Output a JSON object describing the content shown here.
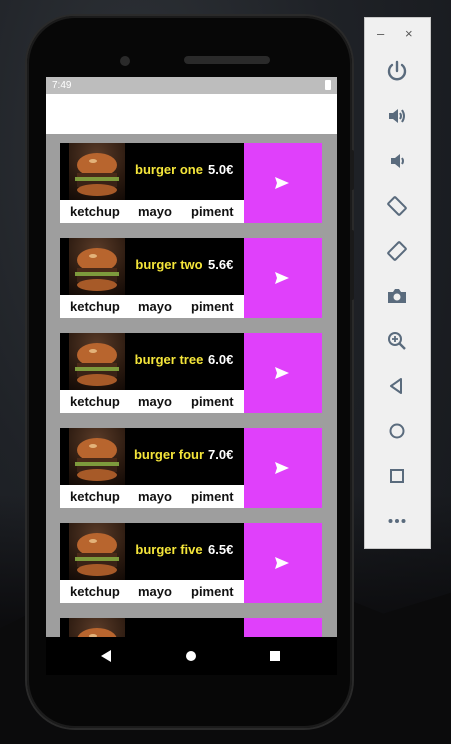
{
  "status_bar": {
    "time": "7:49"
  },
  "items": [
    {
      "name": "burger one",
      "price": "5.0€",
      "sauces": [
        "ketchup",
        "mayo",
        "piment"
      ]
    },
    {
      "name": "burger two",
      "price": "5.6€",
      "sauces": [
        "ketchup",
        "mayo",
        "piment"
      ]
    },
    {
      "name": "burger tree",
      "price": "6.0€",
      "sauces": [
        "ketchup",
        "mayo",
        "piment"
      ]
    },
    {
      "name": "burger four",
      "price": "7.0€",
      "sauces": [
        "ketchup",
        "mayo",
        "piment"
      ]
    },
    {
      "name": "burger five",
      "price": "6.5€",
      "sauces": [
        "ketchup",
        "mayo",
        "piment"
      ]
    }
  ],
  "colors": {
    "accent": "#e040fb",
    "name_text": "#f4e53a",
    "list_background": "#9e9e9e"
  },
  "icons": {
    "send": "send-icon",
    "nav_back": "back-icon",
    "nav_home": "home-icon",
    "nav_recents": "recents-icon",
    "emulator": [
      "power-icon",
      "volume-up-icon",
      "volume-down-icon",
      "rotate-left-icon",
      "rotate-right-icon",
      "camera-icon",
      "zoom-icon",
      "back-icon",
      "home-icon",
      "overview-icon",
      "more-icon"
    ]
  },
  "emulator_window": {
    "minimize": "–",
    "close": "×"
  }
}
